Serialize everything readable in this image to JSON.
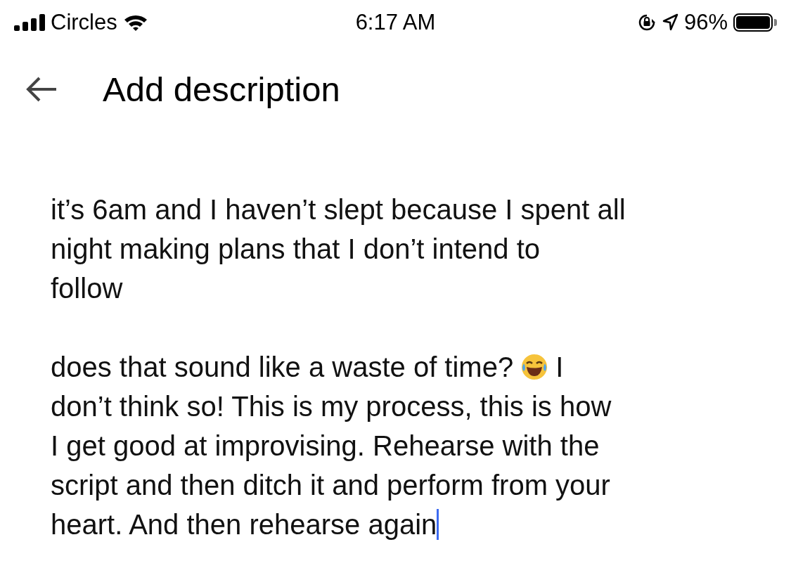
{
  "status_bar": {
    "carrier": "Circles",
    "time": "6:17 AM",
    "battery": "96%"
  },
  "header": {
    "title": "Add description"
  },
  "description": {
    "paragraphs": [
      {
        "lines": [
          [
            {
              "kind": "text",
              "text": "it’s 6am and I haven’t slept because I spent all"
            }
          ],
          [
            {
              "kind": "text",
              "text": "night making plans that I don’t intend to"
            }
          ],
          [
            {
              "kind": "text",
              "text": "follow"
            }
          ]
        ]
      },
      {
        "lines": [
          [
            {
              "kind": "text",
              "text": "does that sound like a waste of time?"
            },
            {
              "kind": "emoji"
            },
            {
              "kind": "text",
              "text": "I"
            }
          ],
          [
            {
              "kind": "text",
              "text": "don’t think so! This is my process, this is how"
            }
          ],
          [
            {
              "kind": "text",
              "text": "I get good at improvising. Rehearse with the"
            }
          ],
          [
            {
              "kind": "text",
              "text": "script and then ditch it and perform from your"
            }
          ],
          [
            {
              "kind": "text",
              "text": "heart. And then rehearse again"
            }
          ]
        ]
      }
    ]
  }
}
